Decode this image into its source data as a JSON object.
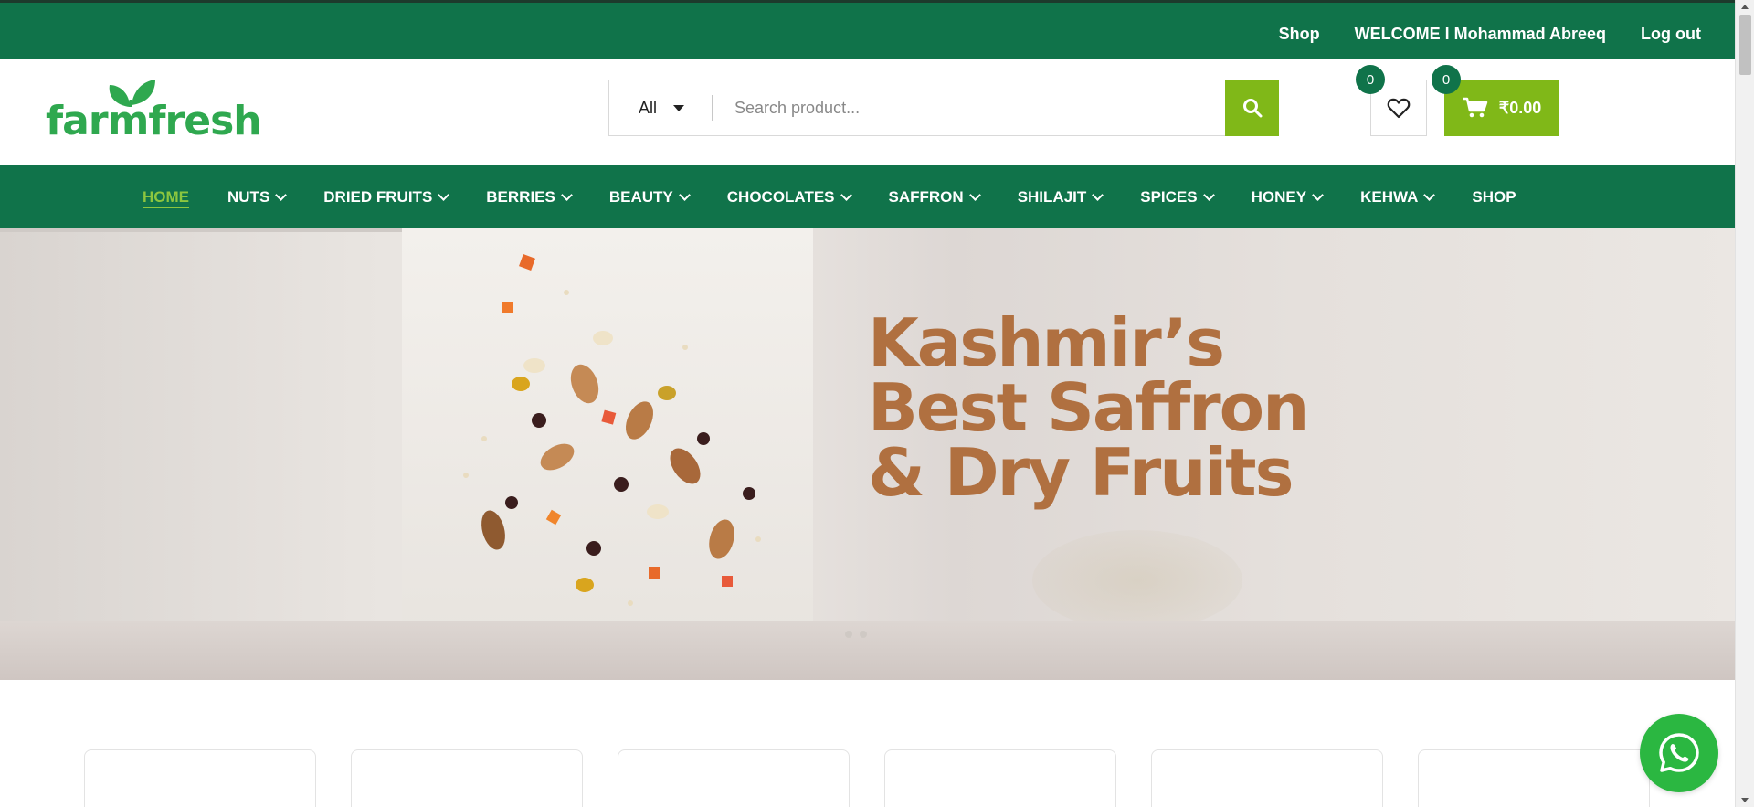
{
  "topbar": {
    "shop_link": "Shop",
    "welcome_text": "WELCOME l Mohammad Abreeq",
    "logout_link": "Log out"
  },
  "header": {
    "logo_text": "farmfresh",
    "search": {
      "category": "All",
      "placeholder": "Search product..."
    },
    "wishlist_count": "0",
    "cart_count": "0",
    "cart_total": "₹0.00"
  },
  "nav": {
    "items": [
      {
        "label": "HOME",
        "active": true,
        "dropdown": false
      },
      {
        "label": "NUTS",
        "dropdown": true
      },
      {
        "label": "DRIED FRUITS",
        "dropdown": true
      },
      {
        "label": "BERRIES",
        "dropdown": true
      },
      {
        "label": "BEAUTY",
        "dropdown": true
      },
      {
        "label": "CHOCOLATES",
        "dropdown": true
      },
      {
        "label": "SAFFRON",
        "dropdown": true
      },
      {
        "label": "SHILAJIT",
        "dropdown": true
      },
      {
        "label": "SPICES",
        "dropdown": true
      },
      {
        "label": "HONEY",
        "dropdown": true
      },
      {
        "label": "KEHWA",
        "dropdown": true
      },
      {
        "label": "SHOP",
        "dropdown": false
      }
    ]
  },
  "hero": {
    "line1": "Kashmir’s",
    "line2": "Best Saffron",
    "line3": "& Dry Fruits"
  },
  "colors": {
    "brand_green": "#10734a",
    "accent_green": "#80b818",
    "hero_text": "#b07040",
    "whatsapp": "#2bb741"
  }
}
